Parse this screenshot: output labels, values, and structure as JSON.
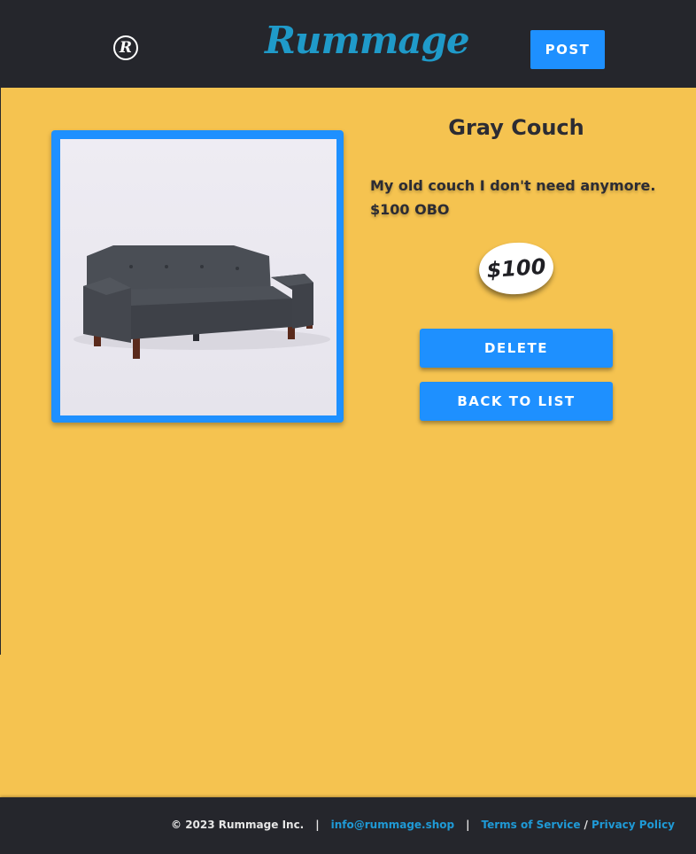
{
  "header": {
    "logo_mark": "R",
    "brand": "Rummage",
    "post_label": "POST"
  },
  "listing": {
    "title": "Gray Couch",
    "description": "My old couch I don't need anymore. $100 OBO",
    "price": "$100",
    "image_alt": "Gray couch photo"
  },
  "actions": {
    "delete_label": "DELETE",
    "back_label": "BACK TO LIST"
  },
  "footer": {
    "copyright": "© 2023 Rummage Inc.",
    "separator": "|",
    "email": "info@rummage.shop",
    "terms": "Terms of Service",
    "slash": "/",
    "privacy": "Privacy Policy"
  },
  "colors": {
    "background": "#f5c350",
    "header": "#25262c",
    "accent": "#1e90ff",
    "brand": "#1f9ac9",
    "link": "#1f9ad6"
  },
  "icons": {
    "logo_mark": "registered-r-icon"
  }
}
